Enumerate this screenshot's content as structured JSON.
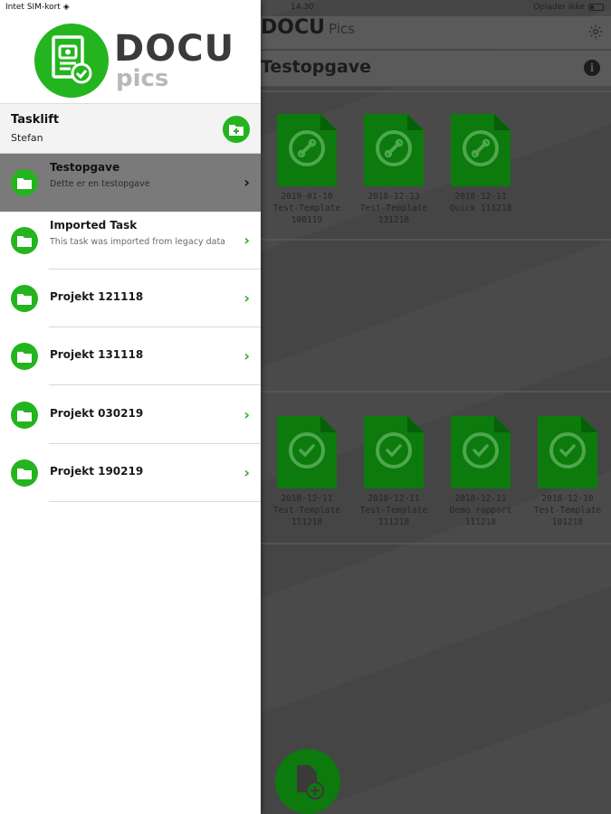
{
  "status_bar": {
    "carrier": "Intet SIM-kort",
    "time": "14.30",
    "battery_text": "Oplader ikke"
  },
  "main": {
    "logo_main": "DOCU",
    "logo_sub": "Pics",
    "task_title": "Testopgave",
    "section1_docs": [
      {
        "date": "2019-01-10",
        "name": "Test-Template",
        "id": "100119",
        "icon": "wrench-icon"
      },
      {
        "date": "2018-12-13",
        "name": "Test-Template",
        "id": "131218",
        "icon": "wrench-icon"
      },
      {
        "date": "2018-12-11",
        "name": "Quick 111218",
        "id": "",
        "icon": "wrench-icon"
      }
    ],
    "section2_docs": [
      {
        "date": "2018-12-11",
        "name": "Test-Template",
        "id": "111218",
        "icon": "check-icon"
      },
      {
        "date": "2018-12-11",
        "name": "Test-Template",
        "id": "111218",
        "icon": "check-icon"
      },
      {
        "date": "2018-12-11",
        "name": "Demo rapport",
        "id": "111218",
        "icon": "check-icon"
      },
      {
        "date": "2018-12-10",
        "name": "Test-Template",
        "id": "101218",
        "icon": "check-icon"
      }
    ]
  },
  "drawer": {
    "logo_docu": "DOCU",
    "logo_pics": "pics",
    "tasklist_title": "Tasklift",
    "tasklist_user": "Stefan",
    "items": [
      {
        "title": "Testopgave",
        "subtitle": "Dette er en testopgave",
        "selected": true
      },
      {
        "title": "Imported Task",
        "subtitle": "This task was imported from legacy data",
        "selected": false
      },
      {
        "title": "Projekt 121118",
        "subtitle": "",
        "selected": false
      },
      {
        "title": "Projekt 131118",
        "subtitle": "",
        "selected": false
      },
      {
        "title": "Projekt 030219",
        "subtitle": "",
        "selected": false
      },
      {
        "title": "Projekt 190219",
        "subtitle": "",
        "selected": false
      }
    ]
  },
  "colors": {
    "accent_green": "#24b41f",
    "dim_green": "#0c7a0c",
    "selected_row": "#7a7a7a"
  }
}
